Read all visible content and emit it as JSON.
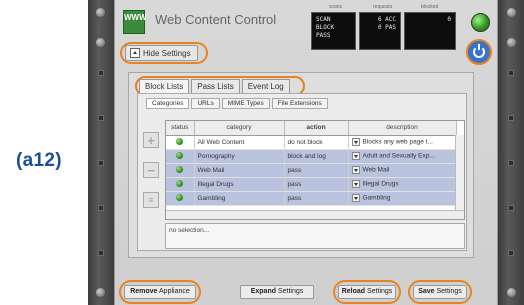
{
  "figure_label": "(a12)",
  "app": {
    "logo_text": "WWW",
    "title": "Web Content Control",
    "hide_settings": "Hide Settings"
  },
  "meters": [
    {
      "label": "scans",
      "lines": [
        "SCAN",
        "BLOCK",
        "PASS"
      ]
    },
    {
      "label": "requests",
      "lines": [
        "6 ACC",
        "",
        "0 PAS"
      ]
    },
    {
      "label": "blocked",
      "lines": [
        "0",
        "",
        ""
      ]
    }
  ],
  "tabs": [
    {
      "label": "Block Lists"
    },
    {
      "label": "Pass Lists"
    },
    {
      "label": "Event Log"
    }
  ],
  "subtabs": [
    {
      "label": "Categories"
    },
    {
      "label": "URLs"
    },
    {
      "label": "MIME Types"
    },
    {
      "label": "File Extensions"
    }
  ],
  "table": {
    "headers": [
      "status",
      "category",
      "action",
      "description"
    ],
    "rows": [
      {
        "category": "All Web Content",
        "action": "do not block",
        "description": "Blocks any web page t..."
      },
      {
        "category": "Pornography",
        "action": "block and log",
        "description": "Adult and Sexually Exp..."
      },
      {
        "category": "Web Mail",
        "action": "pass",
        "description": "Web Mail"
      },
      {
        "category": "Illegal Drugs",
        "action": "pass",
        "description": "Illegal Drugs"
      },
      {
        "category": "Gambling",
        "action": "pass",
        "description": "Gambling"
      }
    ]
  },
  "status_text": "no selection...",
  "buttons": {
    "remove": {
      "bold": "Remove",
      "rest": " Appliance"
    },
    "expand": {
      "bold": "Expand",
      "rest": " Settings"
    },
    "reload": {
      "bold": "Reload",
      "rest": " Settings"
    },
    "save": {
      "bold": "Save",
      "rest": " Settings"
    }
  },
  "colors": {
    "highlight_ring": "#e8831f",
    "status_led": "#2d9a20",
    "selected_row": "#b9c3dd",
    "power_button": "#3a74c8",
    "figure_label": "#1d4e9a"
  }
}
